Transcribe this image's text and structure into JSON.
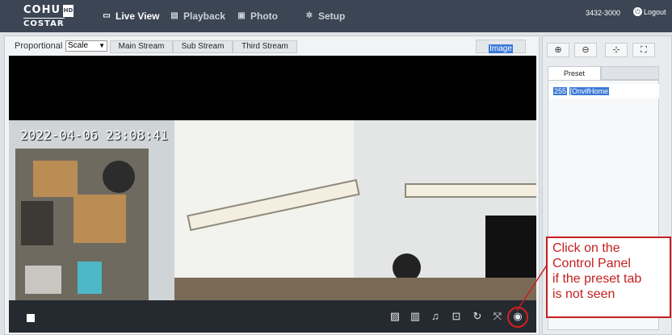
{
  "brand": {
    "line1": "COHU",
    "badge": "HD",
    "line2": "COSTAR"
  },
  "nav": [
    {
      "label": "Live View",
      "icon": "monitor-icon",
      "active": true
    },
    {
      "label": "Playback",
      "icon": "film-icon"
    },
    {
      "label": "Photo",
      "icon": "photo-icon"
    },
    {
      "label": "Setup",
      "icon": "gear-icon"
    }
  ],
  "user": {
    "id": "3432-3000",
    "logout": "Logout"
  },
  "toolbar": {
    "proportional_label": "Proportional",
    "scale_value": "Scale",
    "streams": [
      "Main Stream",
      "Sub Stream",
      "Third Stream"
    ],
    "image_label": "Image"
  },
  "video": {
    "timestamp": "2022-04-06 23:08:41"
  },
  "controls": {
    "icons": [
      "snapshot-icon",
      "record-icon",
      "audio-icon",
      "digital-zoom-icon",
      "ptz-icon",
      "fullscreen-icon",
      "control-panel-icon"
    ]
  },
  "ptz": {
    "icons": [
      "zoom-in-icon",
      "zoom-out-icon",
      "focus-near-icon",
      "focus-far-icon"
    ]
  },
  "preset": {
    "tab_label": "Preset",
    "rows": [
      {
        "number": "255",
        "name": "[OnvifHome"
      }
    ],
    "add_label": "+"
  },
  "callout": {
    "lines": [
      "Click on the",
      "Control Panel",
      "if the preset tab",
      "is not seen"
    ],
    "color": "#c41f1f"
  },
  "colors": {
    "header": "#3b4553",
    "selection": "#3a79d8",
    "accent": "#2a7ad8"
  }
}
